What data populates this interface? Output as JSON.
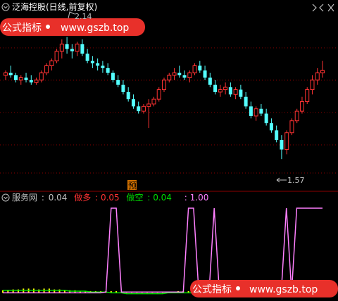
{
  "header": {
    "title": "泛海控股(日线,前复权)",
    "wm_label": "公式指标",
    "wm_url": "www.gszb.top"
  },
  "price_panel": {
    "high_mark": "2.14",
    "low_mark": "1.57",
    "signal_char": "预"
  },
  "indicator_panel": {
    "name": "服务网",
    "sep": ":",
    "v1_label": "0.04",
    "short_label": "做多",
    "short_value": ": 0.05",
    "long_label": "做空",
    "long_value": ": 0.04",
    "extra_value": ": 1.00"
  },
  "colors": {
    "up": "#ff3232",
    "down": "#54ffff",
    "grid": "#8b0000",
    "text": "#c0c0c0",
    "magenta": "#ff80ff",
    "yellow": "#ffff00",
    "green": "#00e000"
  },
  "chart_data": {
    "type": "candlestick",
    "candles": [
      [
        1.95,
        1.97,
        1.93,
        1.96
      ],
      [
        1.96,
        1.99,
        1.94,
        1.95
      ],
      [
        1.95,
        1.96,
        1.92,
        1.93
      ],
      [
        1.93,
        1.95,
        1.91,
        1.94
      ],
      [
        1.94,
        1.96,
        1.92,
        1.93
      ],
      [
        1.93,
        1.95,
        1.91,
        1.92
      ],
      [
        1.92,
        1.94,
        1.91,
        1.93
      ],
      [
        1.93,
        1.97,
        1.92,
        1.96
      ],
      [
        1.96,
        2.0,
        1.95,
        1.99
      ],
      [
        1.99,
        2.02,
        1.97,
        2.01
      ],
      [
        2.01,
        2.06,
        2.0,
        2.05
      ],
      [
        2.05,
        2.1,
        2.02,
        2.08
      ],
      [
        2.08,
        2.11,
        2.04,
        2.06
      ],
      [
        2.06,
        2.08,
        2.02,
        2.05
      ],
      [
        2.05,
        2.09,
        2.03,
        2.08
      ],
      [
        2.08,
        2.1,
        2.03,
        2.04
      ],
      [
        2.04,
        2.06,
        2.0,
        2.01
      ],
      [
        2.01,
        2.03,
        1.98,
        2.0
      ],
      [
        2.0,
        2.02,
        1.97,
        1.99
      ],
      [
        1.99,
        2.01,
        1.96,
        1.98
      ],
      [
        1.98,
        2.0,
        1.95,
        1.96
      ],
      [
        1.96,
        1.97,
        1.92,
        1.93
      ],
      [
        1.93,
        1.95,
        1.9,
        1.91
      ],
      [
        1.91,
        1.93,
        1.87,
        1.88
      ],
      [
        1.88,
        1.9,
        1.84,
        1.85
      ],
      [
        1.85,
        1.87,
        1.81,
        1.82
      ],
      [
        1.82,
        1.84,
        1.79,
        1.8
      ],
      [
        1.8,
        1.83,
        1.79,
        1.82
      ],
      [
        1.82,
        1.85,
        1.73,
        1.83
      ],
      [
        1.83,
        1.86,
        1.82,
        1.85
      ],
      [
        1.85,
        1.9,
        1.84,
        1.89
      ],
      [
        1.89,
        1.94,
        1.88,
        1.93
      ],
      [
        1.93,
        1.96,
        1.92,
        1.95
      ],
      [
        1.95,
        1.98,
        1.93,
        1.96
      ],
      [
        1.96,
        1.99,
        1.94,
        1.95
      ],
      [
        1.95,
        1.97,
        1.93,
        1.94
      ],
      [
        1.94,
        1.97,
        1.92,
        1.96
      ],
      [
        1.96,
        2.0,
        1.95,
        1.99
      ],
      [
        1.99,
        2.01,
        1.96,
        1.97
      ],
      [
        1.97,
        1.99,
        1.93,
        1.94
      ],
      [
        1.94,
        1.96,
        1.9,
        1.91
      ],
      [
        1.91,
        1.93,
        1.87,
        1.88
      ],
      [
        1.88,
        1.91,
        1.86,
        1.89
      ],
      [
        1.89,
        1.92,
        1.87,
        1.9
      ],
      [
        1.9,
        1.92,
        1.86,
        1.87
      ],
      [
        1.87,
        1.9,
        1.85,
        1.89
      ],
      [
        1.89,
        1.91,
        1.85,
        1.86
      ],
      [
        1.86,
        1.88,
        1.81,
        1.82
      ],
      [
        1.82,
        1.84,
        1.77,
        1.78
      ],
      [
        1.78,
        1.82,
        1.76,
        1.81
      ],
      [
        1.81,
        1.83,
        1.78,
        1.79
      ],
      [
        1.79,
        1.81,
        1.74,
        1.75
      ],
      [
        1.75,
        1.77,
        1.71,
        1.72
      ],
      [
        1.72,
        1.74,
        1.67,
        1.68
      ],
      [
        1.68,
        1.7,
        1.6,
        1.64
      ],
      [
        1.64,
        1.72,
        1.62,
        1.71
      ],
      [
        1.71,
        1.77,
        1.7,
        1.76
      ],
      [
        1.76,
        1.81,
        1.75,
        1.8
      ],
      [
        1.8,
        1.86,
        1.79,
        1.84
      ],
      [
        1.84,
        1.9,
        1.83,
        1.89
      ],
      [
        1.89,
        1.95,
        1.87,
        1.93
      ],
      [
        1.93,
        1.98,
        1.91,
        1.96
      ],
      [
        1.96,
        2.01,
        1.94,
        1.97
      ]
    ],
    "indicator": {
      "bars": [
        0.03,
        0.03,
        0.04,
        0.04,
        0.05,
        0.05,
        0.05,
        0.04,
        0.05,
        0.05,
        0.04,
        0.04,
        0.03,
        0.03,
        0.03,
        0.02,
        0.02,
        0.02,
        0.02,
        0.02,
        0.02,
        0.02,
        0.02,
        0.01,
        0.01,
        0.01,
        0.01,
        0.01,
        0.01,
        0.01,
        0.01,
        0.01,
        0.01,
        0.01,
        0.02,
        0.02,
        0.02,
        0.03,
        0.03,
        0.03,
        0.03,
        0.02,
        0.02,
        0.02,
        0.02,
        0.02,
        0.01,
        0.01,
        0.01,
        0.01,
        0.01,
        0.01,
        0.01,
        0.01,
        0.02,
        0.03,
        0.03,
        0.04,
        0.04,
        0.05,
        0.05,
        0.05,
        0.05
      ],
      "green_line": [
        0.03,
        0.03,
        0.03,
        0.03,
        0.03,
        0.03,
        0.03,
        0.03,
        0.03,
        0.03,
        0.03,
        0.03,
        0.03,
        0.02,
        0.02,
        0.02,
        0.02,
        0.01,
        0.01,
        0.01,
        0.01,
        0.0,
        0.0,
        0.0,
        -0.01,
        -0.01,
        -0.01,
        -0.01,
        -0.01,
        -0.01,
        -0.01,
        -0.01,
        0.0,
        0.0,
        0.0,
        0.0,
        0.0,
        0.0,
        0.0,
        0.0,
        0.0,
        0.0,
        0.0,
        0.0,
        0.0,
        0.0,
        0.0,
        0.0,
        0.0,
        -0.01,
        -0.01,
        -0.01,
        -0.01,
        -0.01,
        0.0,
        0.0,
        0.0,
        0.01,
        0.01,
        0.01,
        0.02,
        0.02,
        0.02
      ],
      "magenta_line": [
        0,
        0,
        0,
        0,
        0,
        0,
        0,
        0,
        0,
        0,
        0,
        0,
        0,
        0,
        0,
        0,
        0,
        0,
        0,
        0,
        0.01,
        1,
        1,
        0.01,
        0.01,
        0.01,
        0.01,
        0.01,
        0.01,
        0.01,
        0.01,
        0.01,
        0.01,
        0.01,
        0.01,
        0.01,
        1,
        1,
        0.01,
        0.01,
        0.01,
        1,
        0.01,
        0.01,
        0.01,
        0.01,
        0.01,
        0.01,
        0.01,
        0.01,
        0.01,
        0.01,
        0.01,
        0.01,
        0.01,
        1,
        0.01,
        1,
        1,
        1,
        1,
        1,
        1
      ],
      "ylim": [
        -0.03,
        1.05
      ]
    },
    "price_ylim": [
      1.53,
      2.2
    ]
  }
}
